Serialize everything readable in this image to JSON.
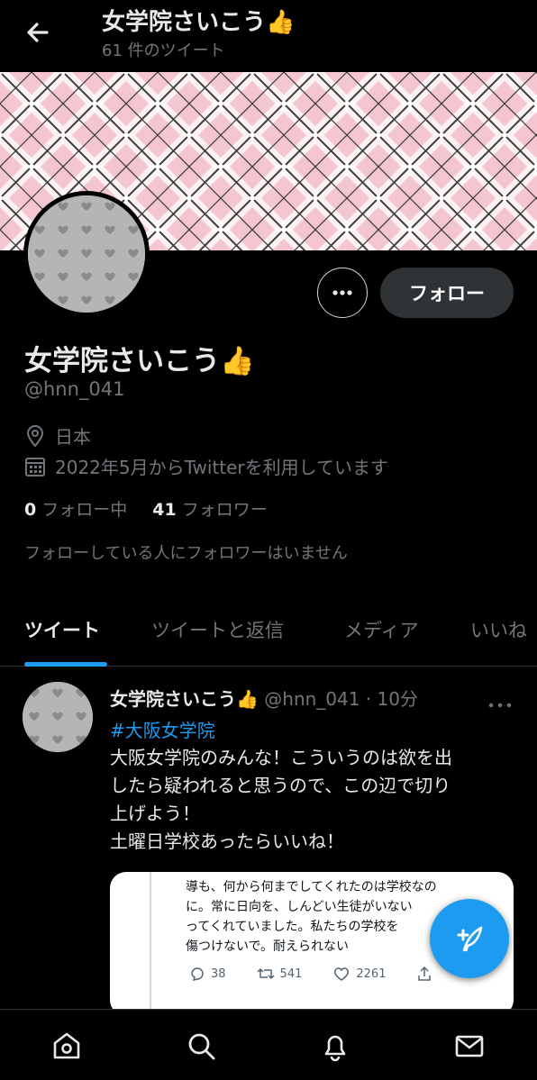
{
  "header": {
    "title": "女学院さいこう👍",
    "tweet_count": "61 件のツイート"
  },
  "colors": {
    "background": "#000000",
    "accent": "#1d9bf0",
    "banner": "#f4c6cf",
    "muted_text": "#71767b"
  },
  "profile": {
    "display_name": "女学院さいこう👍",
    "handle": "@hnn_041",
    "location": "日本",
    "joined": "2022年5月からTwitterを利用しています",
    "following_count": "0",
    "following_label": "フォロー中",
    "followers_count": "41",
    "followers_label": "フォロワー",
    "followers_note": "フォローしている人にフォロワーはいません",
    "follow_button": "フォロー"
  },
  "tabs": [
    {
      "label": "ツイート",
      "active": true
    },
    {
      "label": "ツイートと返信",
      "active": false
    },
    {
      "label": "メディア",
      "active": false
    },
    {
      "label": "いいね",
      "active": false
    }
  ],
  "tweet": {
    "name": "女学院さいこう👍",
    "handle_time": "@hnn_041 · 10分",
    "hashtag": "#大阪女学院",
    "lines": [
      "大阪女学院のみんな！こういうのは欲を出",
      "したら疑われると思うので、この辺で切り",
      "上げよう！",
      "土曜日学校あったらいいね！"
    ],
    "quoted": {
      "lines": [
        "導も、何から何までしてくれたのは学校なの",
        "に。常に日向を、しんどい生徒がいない",
        "ってくれていました。私たちの学校を",
        "傷つけないで。耐えられない"
      ],
      "replies": "38",
      "retweets": "541",
      "likes": "2261"
    }
  },
  "icons": {
    "back": "arrow-left-icon",
    "more": "more-horizontal-icon",
    "location": "location-pin-icon",
    "calendar": "calendar-icon",
    "compose": "compose-tweet-icon",
    "home": "home-icon",
    "search": "search-icon",
    "notifications": "bell-icon",
    "messages": "envelope-icon"
  }
}
